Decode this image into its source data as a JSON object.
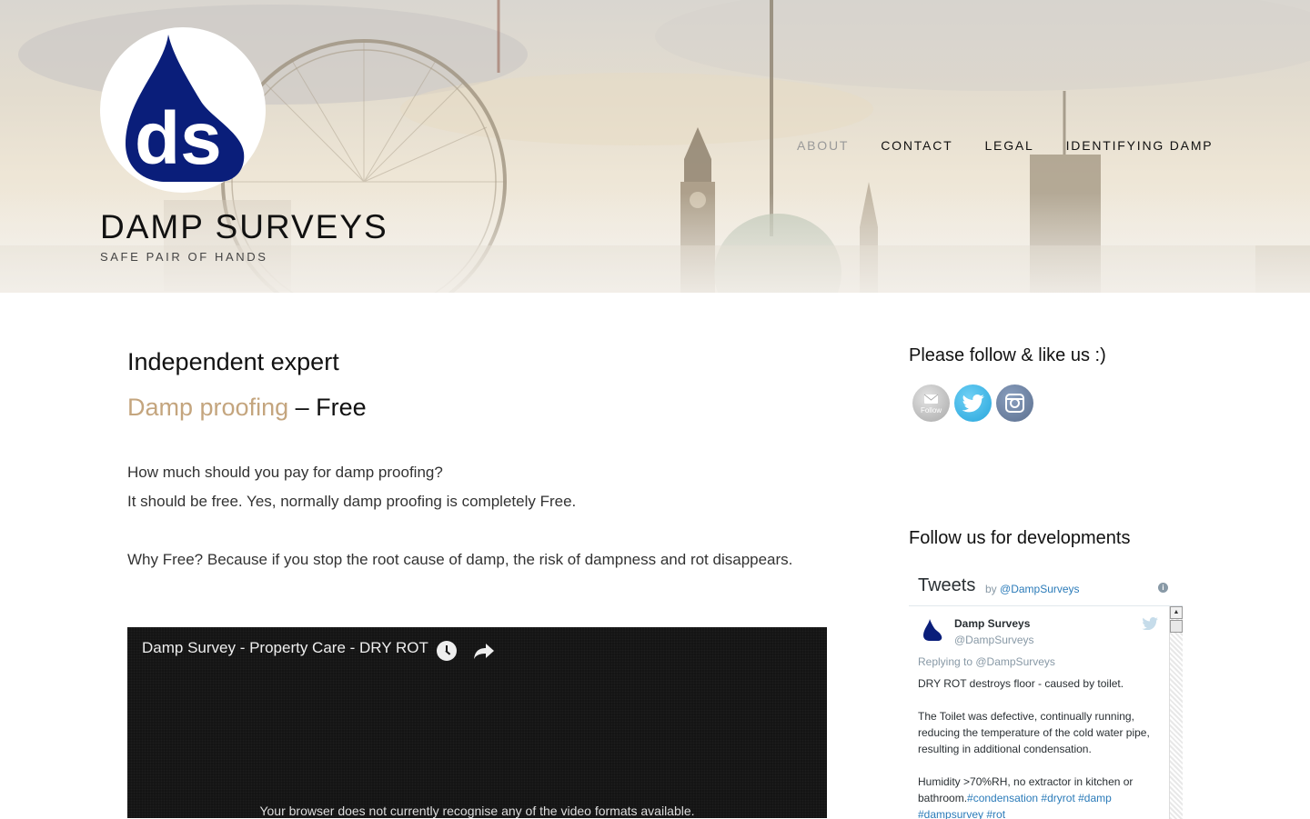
{
  "header": {
    "site_title": "DAMP SURVEYS",
    "tagline": "SAFE PAIR OF HANDS",
    "logo_text": "ds"
  },
  "nav": {
    "items": [
      {
        "label": "ABOUT",
        "active": true
      },
      {
        "label": "CONTACT",
        "active": false
      },
      {
        "label": "LEGAL",
        "active": false
      },
      {
        "label": "IDENTIFYING DAMP",
        "active": false
      }
    ]
  },
  "main": {
    "heading": "Independent expert",
    "subheading_link": "Damp proofing",
    "subheading_rest": " – Free",
    "para1_line1": "How much should you pay for damp proofing?",
    "para1_line2": "It should be free. Yes, normally damp proofing is completely Free.",
    "para2": "Why Free? Because if you stop the root cause of damp, the risk of dampness and rot disappears.",
    "video": {
      "title": "Damp Survey - Property Care - DRY ROT",
      "message": "Your browser does not currently recognise any of the video formats available."
    }
  },
  "sidebar": {
    "follow_heading": "Please follow & like us :)",
    "social": {
      "mail_label": "Follow",
      "mail_icon": "email-follow-icon",
      "twitter_icon": "twitter-icon",
      "instagram_icon": "instagram-icon"
    },
    "developments_heading": "Follow us for developments",
    "tweets": {
      "title": "Tweets",
      "by_prefix": "by ",
      "by_handle": "@DampSurveys",
      "info": "i",
      "tweet": {
        "name": "Damp Surveys",
        "handle": "@DampSurveys",
        "reply_to": "Replying to @DampSurveys",
        "line1": "DRY ROT destroys floor - caused by toilet.",
        "line2": "The Toilet was defective, continually running, reducing the temperature of the cold water pipe, resulting in additional condensation.",
        "line3_text": "Humidity >70%RH, no extractor in kitchen or bathroom.",
        "hashtags_a": "#condensation #dryrot #damp",
        "hashtags_b": "#dampsurvey #rot"
      }
    }
  },
  "colors": {
    "accent_link": "#c4a57e",
    "logo_blue": "#0a1e7a",
    "twitter_blue": "#2b7bb9"
  }
}
